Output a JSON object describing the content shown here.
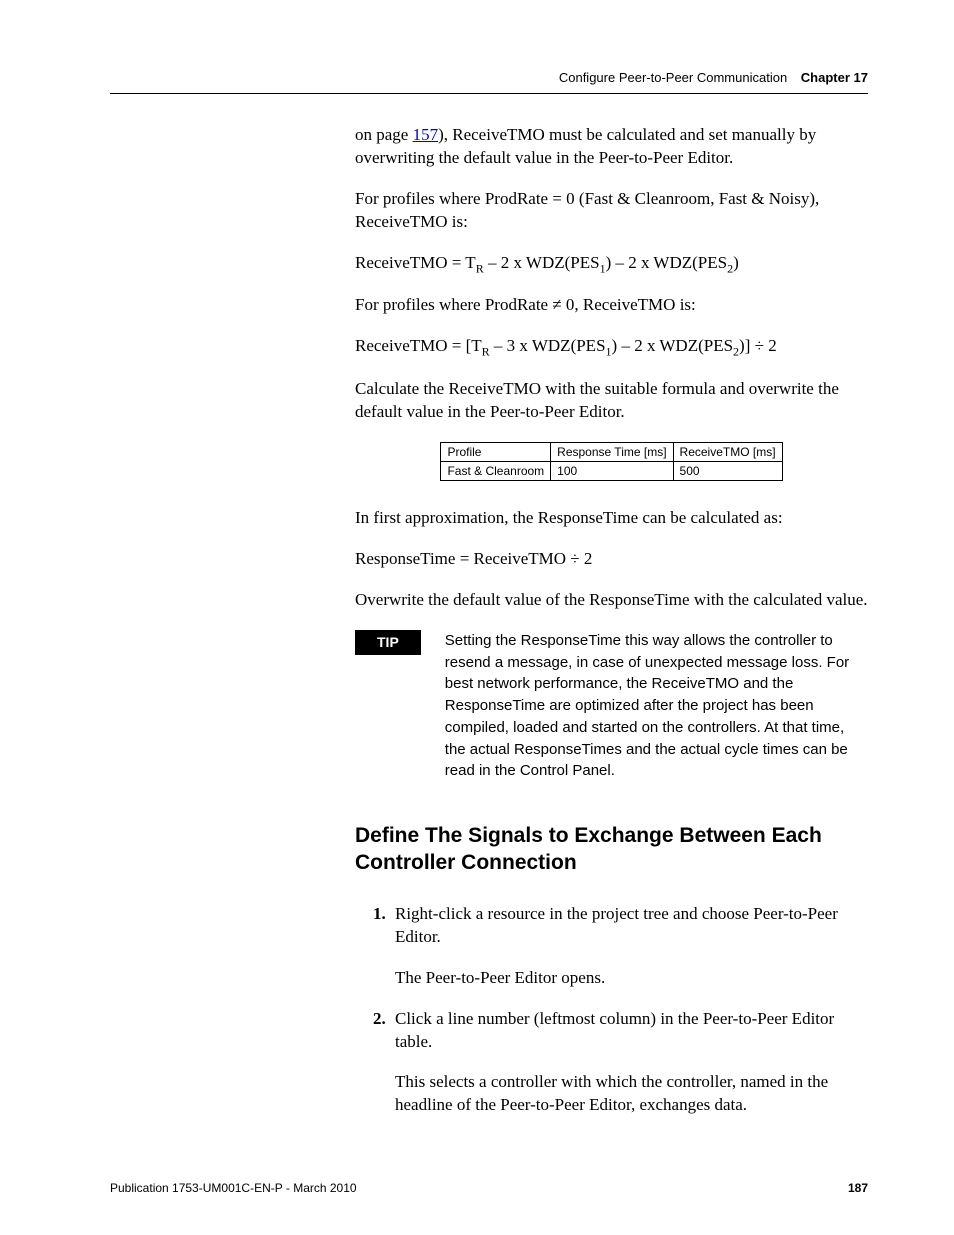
{
  "header": {
    "breadcrumb": "Configure Peer-to-Peer Communication",
    "chapter": "Chapter 17"
  },
  "intro": {
    "p1a": "on page ",
    "p1_link": "157",
    "p1b": "), ReceiveTMO must be calculated and set manually by overwriting the default value in the Peer-to-Peer Editor.",
    "p2": "For profiles where ProdRate = 0 (Fast & Cleanroom, Fast & Noisy), ReceiveTMO is:",
    "formula1_a": "ReceiveTMO = T",
    "formula1_b": " – 2 x WDZ(PES",
    "formula1_c": ") – 2 x WDZ(PES",
    "formula1_d": ")",
    "p3": "For profiles where ProdRate ≠ 0, ReceiveTMO is:",
    "formula2_a": "ReceiveTMO = [T",
    "formula2_b": " – 3 x WDZ(PES",
    "formula2_c": ") – 2 x WDZ(PES",
    "formula2_d": ")] ÷ 2",
    "sub_R": "R",
    "sub_1": "1",
    "sub_2": "2",
    "p4": "Calculate the ReceiveTMO with the suitable formula and overwrite the default value in the Peer-to-Peer Editor."
  },
  "table": {
    "h1": "Profile",
    "h2": "Response Time [ms]",
    "h3": "ReceiveTMO [ms]",
    "r1c1": "Fast & Cleanroom",
    "r1c2": "100",
    "r1c3": "500"
  },
  "after_table": {
    "p1": "In first approximation, the ResponseTime can be calculated as:",
    "formula": "ResponseTime = ReceiveTMO ÷ 2",
    "p2": "Overwrite the default value of the ResponseTime with the calculated value."
  },
  "tip": {
    "badge": "TIP",
    "text": "Setting the ResponseTime this way allows the controller to resend a message, in case of unexpected message loss. For best network performance, the ReceiveTMO and the ResponseTime are optimized after the project has been compiled, loaded and started on the controllers. At that time, the actual ResponseTimes and the actual cycle times can be read in the Control Panel."
  },
  "section": {
    "heading": "Define The Signals to Exchange Between Each Controller Connection",
    "steps": [
      {
        "num": "1.",
        "text": "Right-click a resource in the project tree and choose Peer-to-Peer Editor.",
        "extra": " The Peer-to-Peer Editor opens."
      },
      {
        "num": "2.",
        "text": "Click a line number (leftmost column) in the Peer-to-Peer Editor table.",
        "extra": "This selects a controller with which the controller, named in the headline of the Peer-to-Peer Editor, exchanges data."
      }
    ]
  },
  "footer": {
    "pub": "Publication 1753-UM001C-EN-P - March 2010",
    "page": "187"
  }
}
